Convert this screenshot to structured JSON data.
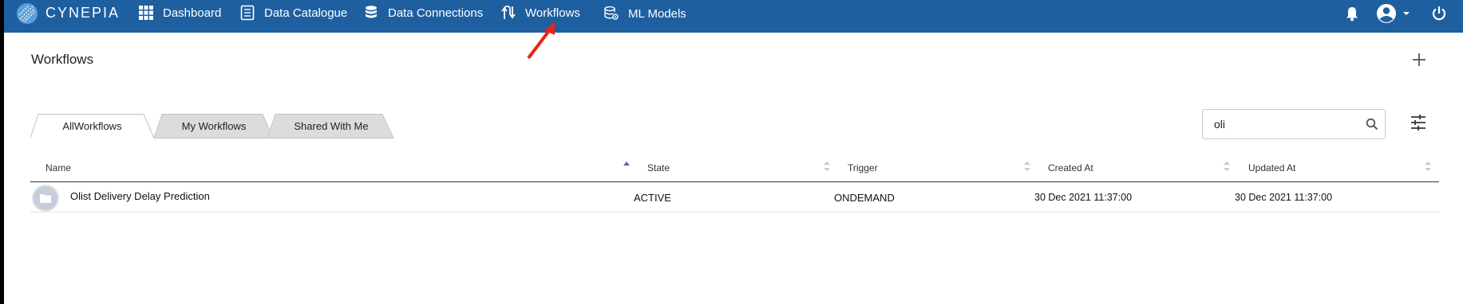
{
  "navbar": {
    "brand": "CYNEPIA",
    "items": [
      {
        "label": "Dashboard",
        "icon": "grid-icon"
      },
      {
        "label": "Data Catalogue",
        "icon": "document-list-icon"
      },
      {
        "label": "Data Connections",
        "icon": "database-icon"
      },
      {
        "label": "Workflows",
        "icon": "workflow-arrows-icon"
      },
      {
        "label": "ML Models",
        "icon": "database-gear-icon"
      }
    ],
    "right_icons": [
      "bell-icon",
      "user-avatar-icon",
      "power-icon"
    ],
    "background_color": "#1e5fa0"
  },
  "page": {
    "title": "Workflows"
  },
  "tabs": [
    {
      "label": "AllWorkflows",
      "active": true
    },
    {
      "label": "My Workflows",
      "active": false
    },
    {
      "label": "Shared With Me",
      "active": false
    }
  ],
  "search": {
    "value": "oli"
  },
  "table": {
    "columns": [
      "Name",
      "State",
      "Trigger",
      "Created At",
      "Updated At"
    ],
    "sorted_column": "Name",
    "rows": [
      {
        "name": "Olist Delivery Delay Prediction",
        "state": "ACTIVE",
        "trigger": "ONDEMAND",
        "created_at": "30 Dec 2021 11:37:00",
        "updated_at": "30 Dec 2021 11:37:00"
      }
    ]
  },
  "annotation": {
    "arrow_color": "#e8231c"
  }
}
